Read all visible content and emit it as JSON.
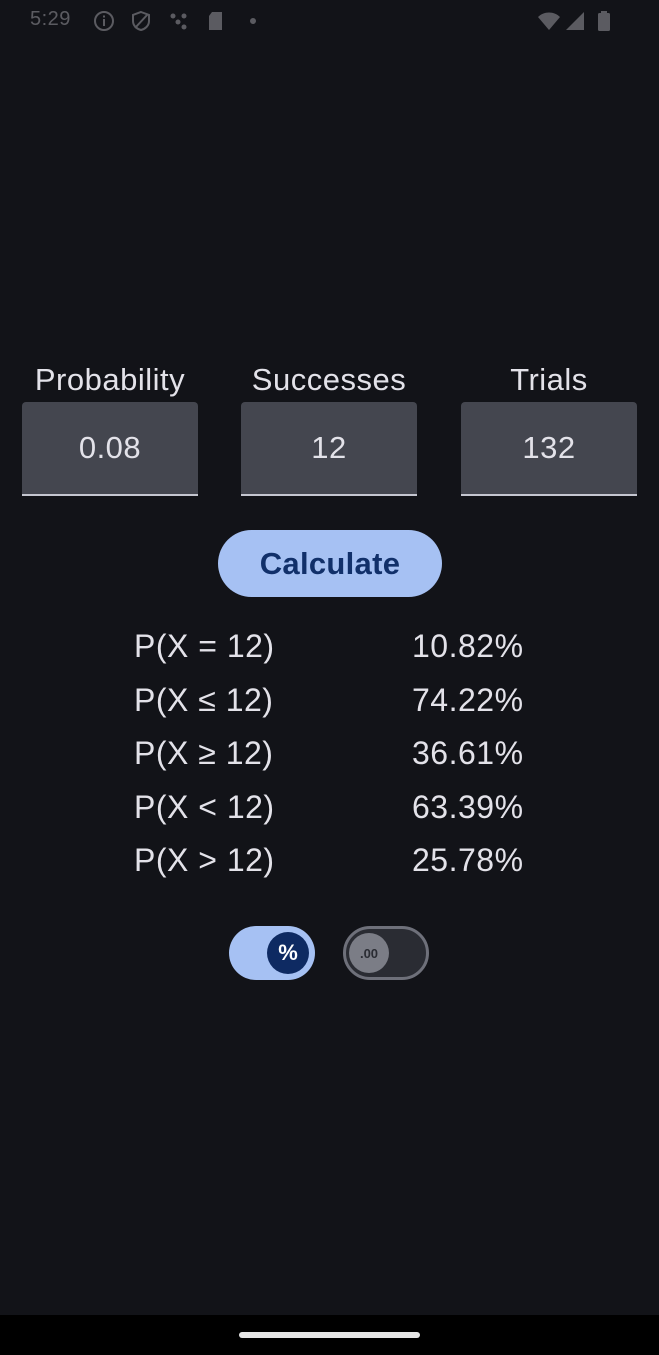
{
  "status_bar": {
    "time": "5:29",
    "left_icons": [
      "info-icon",
      "shield-icon",
      "dots-icon",
      "sd-card-icon",
      "dot-icon"
    ],
    "right_icons": [
      "wifi-icon",
      "signal-icon",
      "battery-icon"
    ]
  },
  "inputs": {
    "probability": {
      "label": "Probability",
      "value": "0.08"
    },
    "successes": {
      "label": "Successes",
      "value": "12"
    },
    "trials": {
      "label": "Trials",
      "value": "132"
    }
  },
  "calculate_label": "Calculate",
  "results": [
    {
      "label": "P(X = 12)",
      "value": "10.82%"
    },
    {
      "label": "P(X ≤ 12)",
      "value": "74.22%"
    },
    {
      "label": "P(X ≥ 12)",
      "value": "36.61%"
    },
    {
      "label": "P(X < 12)",
      "value": "63.39%"
    },
    {
      "label": "P(X > 12)",
      "value": "25.78%"
    }
  ],
  "toggles": {
    "percent": {
      "icon": "percent-icon",
      "glyph": "%",
      "on": true
    },
    "decimal": {
      "icon": "decimal-icon",
      "glyph": ".00",
      "on": false
    }
  },
  "colors": {
    "background": "#121318",
    "accent": "#a6c1f3",
    "accent_dark": "#11306a",
    "field": "#44464f"
  }
}
